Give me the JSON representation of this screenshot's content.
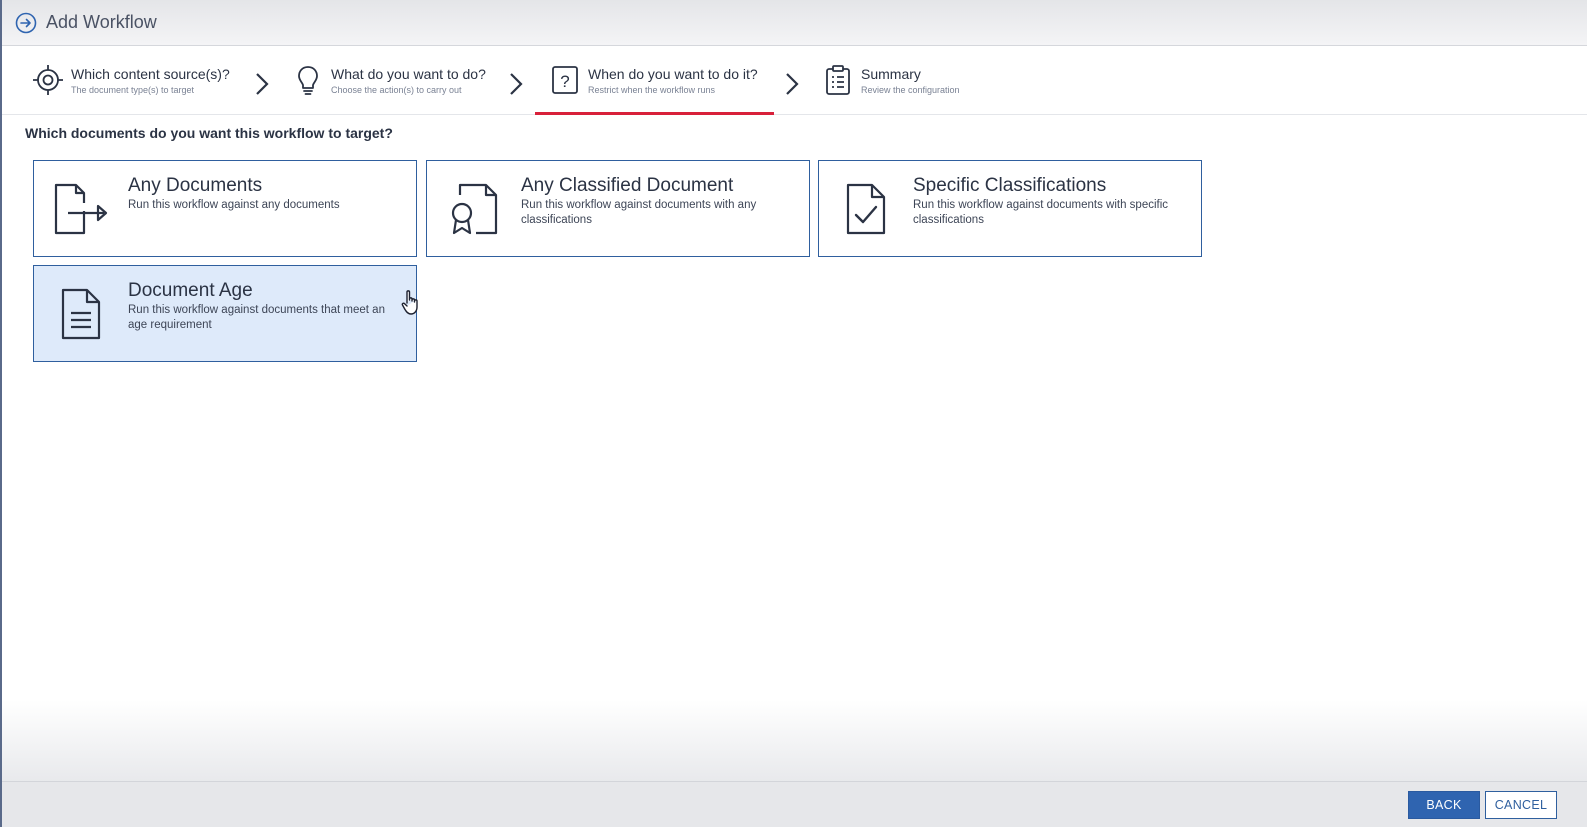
{
  "header": {
    "title": "Add Workflow",
    "icon": "arrow-right-circle-icon"
  },
  "steps": [
    {
      "title": "Which content source(s)?",
      "subtitle": "The document type(s) to target",
      "icon": "target-icon"
    },
    {
      "title": "What do you want to do?",
      "subtitle": "Choose the action(s) to carry out",
      "icon": "lightbulb-icon"
    },
    {
      "title": "When do you want to do it?",
      "subtitle": "Restrict when the workflow runs",
      "icon": "question-box-icon",
      "active": true
    },
    {
      "title": "Summary",
      "subtitle": "Review the configuration",
      "icon": "clipboard-list-icon"
    }
  ],
  "main": {
    "question": "Which documents do you want this workflow to target?",
    "options": [
      {
        "title": "Any Documents",
        "description": "Run this workflow against any documents",
        "icon": "document-export-icon"
      },
      {
        "title": "Any Classified Document",
        "description": "Run this workflow against documents with any classifications",
        "icon": "document-badge-icon"
      },
      {
        "title": "Specific Classifications",
        "description": "Run this workflow against documents with specific classifications",
        "icon": "document-check-icon"
      },
      {
        "title": "Document Age",
        "description": "Run this workflow against documents that meet an age requirement",
        "icon": "document-lines-icon",
        "hovered": true
      }
    ]
  },
  "footer": {
    "back_label": "BACK",
    "cancel_label": "CANCEL"
  },
  "colors": {
    "accent": "#2f5f9e",
    "active_step_underline": "#d8203a",
    "card_hover_bg": "#deeafa",
    "primary_button": "#2f64b0"
  }
}
